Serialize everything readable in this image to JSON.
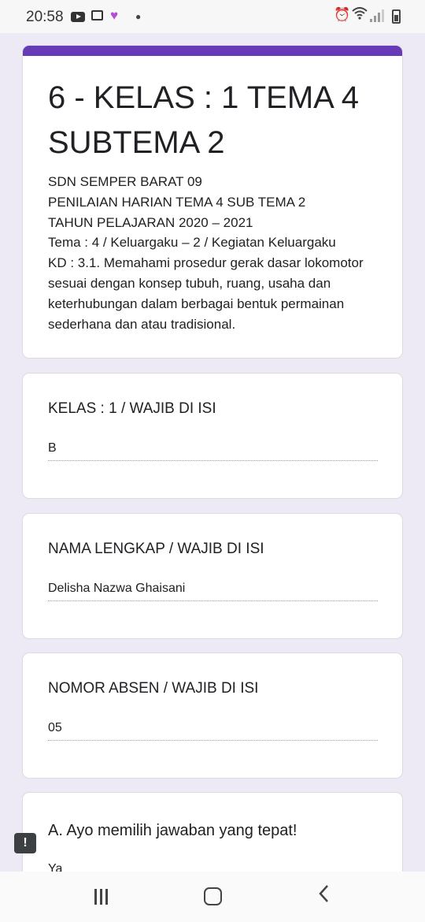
{
  "status_bar": {
    "time": "20:58",
    "icons": [
      "youtube-icon",
      "gallery-icon",
      "heart-app-icon",
      "dot-icon",
      "alarm-icon",
      "wifi-icon",
      "signal-icon",
      "battery-icon"
    ]
  },
  "form": {
    "accent_color": "#673ab7",
    "title": "6 - KELAS : 1 TEMA 4 SUBTEMA 2",
    "description": "SDN SEMPER BARAT 09\nPENILAIAN HARIAN TEMA 4 SUB TEMA 2\nTAHUN PELAJARAN  2020 – 2021\nTema : 4 / Keluargaku – 2 / Kegiatan Keluargaku\nKD : 3.1. Memahami prosedur gerak dasar lokomotor sesuai dengan konsep tubuh, ruang, usaha dan keterhubungan dalam berbagai bentuk permainan sederhana dan atau tradisional."
  },
  "questions": [
    {
      "title": "KELAS : 1 / WAJIB DI ISI",
      "answer": "B"
    },
    {
      "title": "NAMA LENGKAP / WAJIB DI ISI",
      "answer": "Delisha Nazwa Ghaisani"
    },
    {
      "title": "NOMOR ABSEN / WAJIB DI ISI",
      "answer": "05"
    },
    {
      "title": "A. Ayo memilih jawaban yang tepat!",
      "answer": "Ya"
    }
  ],
  "feedback_button": {
    "label": "!"
  },
  "nav_bar": {
    "buttons": [
      "recent-apps",
      "home",
      "back"
    ],
    "back_glyph": "<"
  }
}
